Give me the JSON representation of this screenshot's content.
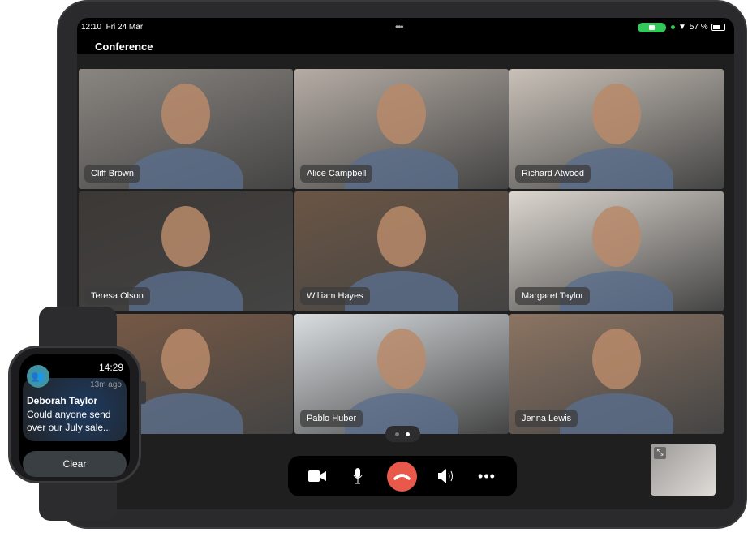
{
  "status_bar": {
    "time": "12:10",
    "date": "Fri 24 Mar",
    "battery": "57 %",
    "camera_active_color": "#34c759"
  },
  "app": {
    "title": "Conference"
  },
  "participants": [
    {
      "name": "Cliff Brown",
      "bg": "#8a8580"
    },
    {
      "name": "Alice Campbell",
      "bg": "#b5aca4"
    },
    {
      "name": "Richard Atwood",
      "bg": "#c9c1b8"
    },
    {
      "name": "Teresa Olson",
      "bg": "#3c3835"
    },
    {
      "name": "William Hayes",
      "bg": "#6a5544"
    },
    {
      "name": "Margaret Taylor",
      "bg": "#dcd6cf"
    },
    {
      "name": "",
      "bg": "#7a5a45"
    },
    {
      "name": "Pablo Huber",
      "bg": "#d9dde0"
    },
    {
      "name": "Jenna Lewis",
      "bg": "#8c7462"
    }
  ],
  "pager": {
    "pages": 2,
    "current": 2
  },
  "controls": {
    "end_call_color": "#e8594b",
    "icons": [
      "video-camera-icon",
      "microphone-icon",
      "end-call-icon",
      "speaker-icon",
      "more-icon"
    ]
  },
  "watch": {
    "time": "14:29",
    "notification": {
      "ago": "13m ago",
      "sender": "Deborah Taylor",
      "message": "Could anyone send over our July sale...",
      "app_icon_color": "#3f93a5"
    },
    "clear_label": "Clear"
  }
}
